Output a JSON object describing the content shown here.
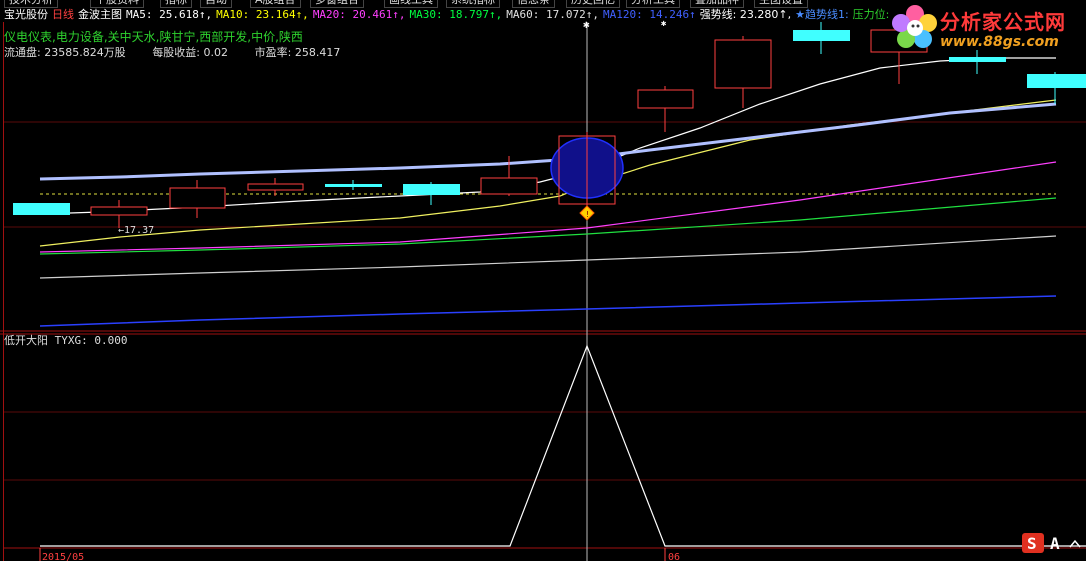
{
  "top_tabs": [
    "技术分析",
    "个股资料",
    "指标",
    "自动",
    "A股组合",
    "多窗组合",
    "画线工具",
    "系统指标",
    "信息条",
    "历史回忆",
    "分析工具",
    "叠加品种",
    "主图设置"
  ],
  "header": {
    "stock_name": "宝光股份",
    "period": "日线",
    "indicator": "金波主图",
    "ma5": "MA5: 25.618↑,",
    "ma10": "MA10: 23.164↑,",
    "ma20": "MA20: 20.461↑,",
    "ma30": "MA30: 18.797↑,",
    "ma60": "MA60: 17.072↑,",
    "ma120": "MA120: 14.246↑",
    "strong_line": "强势线: 23.280↑,",
    "trend_line": "★趋势线1:",
    "pressure": "压力位:"
  },
  "sectors": "仪电仪表,电力设备,关中天水,陕甘宁,西部开发,中价,陕西",
  "stats": {
    "float_shares": "流通盘: 23585.824万股",
    "eps": "每股收益: 0.02",
    "pe": "市盈率: 258.417"
  },
  "price_marker": "←17.37",
  "sub_panel": {
    "title": "低开大阳",
    "value": "TYXG: 0.000"
  },
  "date_labels": [
    "2015/05",
    "06"
  ],
  "logo": {
    "title": "分析家公式网",
    "url": "www.88gs.com"
  },
  "watermark_letters": [
    "S",
    "A"
  ],
  "colors": {
    "background": "#000000",
    "up_candle": "#ff4040",
    "down_candle": "#40ffff",
    "ma5": "#ffffff",
    "ma10": "#ffff00",
    "ma20": "#ff40ff",
    "ma30": "#00ff00",
    "ma60": "#d0d0d0",
    "ma120": "#2a40ff",
    "strong_line": "#b0c0ff"
  }
}
